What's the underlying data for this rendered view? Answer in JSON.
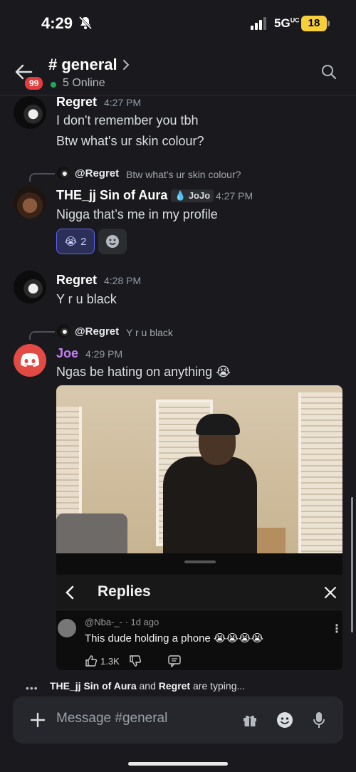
{
  "status_bar": {
    "time": "4:29",
    "network": "5G",
    "network_sub": "UC",
    "battery": "18"
  },
  "header": {
    "badge": "99",
    "channel": "# general",
    "online": "5 Online"
  },
  "messages": [
    {
      "author": "Regret",
      "time": "4:27 PM",
      "lines": [
        "I don't remember you tbh",
        "Btw what's ur skin colour?"
      ]
    },
    {
      "reply_to": "@Regret",
      "reply_text": "Btw what's ur skin colour?",
      "author": "THE_jj Sin of Aura",
      "role_tag": "JoJo",
      "time": "4:27 PM",
      "text": "Nigga that’s me in my profile",
      "reaction": {
        "emoji": "😭",
        "count": "2"
      }
    },
    {
      "author": "Regret",
      "time": "4:28 PM",
      "text": "Y r u black"
    },
    {
      "reply_to": "@Regret",
      "reply_text": "Y r u black",
      "author": "Joe",
      "time": "4:29 PM",
      "text": "Ngas be hating on anything 😭"
    }
  ],
  "embed": {
    "replies_title": "Replies",
    "reply_user": "@Nba-_- · 1d ago",
    "reply_text": "This dude holding a phone 😭😭😭😭",
    "reply_likes": "1.3K"
  },
  "typing": {
    "dots": "•••",
    "user1": "THE_jj Sin of Aura",
    "and": " and ",
    "user2": "Regret",
    "suffix": " are typing..."
  },
  "composer": {
    "placeholder": "Message #general"
  },
  "colors": {
    "background": "#1a1a1e",
    "joe_name": "#c27ff3",
    "online": "#23a55a",
    "badge": "#e23c3c",
    "battery": "#f7cf3b",
    "reaction_active": "#5865f2"
  }
}
